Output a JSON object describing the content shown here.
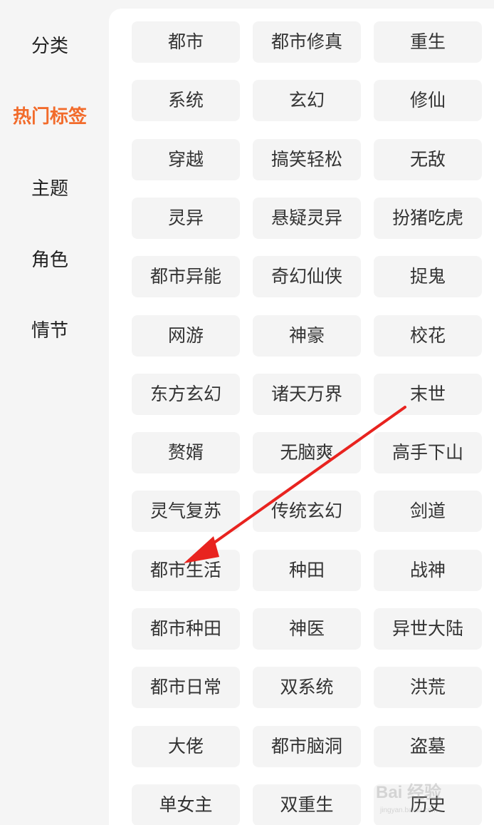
{
  "sidebar": {
    "items": [
      {
        "label": "分类",
        "active": false
      },
      {
        "label": "热门标签",
        "active": true
      },
      {
        "label": "主题",
        "active": false
      },
      {
        "label": "角色",
        "active": false
      },
      {
        "label": "情节",
        "active": false
      }
    ]
  },
  "tags": [
    [
      "都市",
      "都市修真",
      "重生"
    ],
    [
      "系统",
      "玄幻",
      "修仙"
    ],
    [
      "穿越",
      "搞笑轻松",
      "无敌"
    ],
    [
      "灵异",
      "悬疑灵异",
      "扮猪吃虎"
    ],
    [
      "都市异能",
      "奇幻仙侠",
      "捉鬼"
    ],
    [
      "网游",
      "神豪",
      "校花"
    ],
    [
      "东方玄幻",
      "诸天万界",
      "末世"
    ],
    [
      "赘婿",
      "无脑爽",
      "高手下山"
    ],
    [
      "灵气复苏",
      "传统玄幻",
      "剑道"
    ],
    [
      "都市生活",
      "种田",
      "战神"
    ],
    [
      "都市种田",
      "神医",
      "异世大陆"
    ],
    [
      "都市日常",
      "双系统",
      "洪荒"
    ],
    [
      "大佬",
      "都市脑洞",
      "盗墓"
    ],
    [
      "单女主",
      "双重生",
      "历史"
    ]
  ],
  "annotation": {
    "color": "#e8231f",
    "points_to": "都市生活"
  },
  "watermark": {
    "text": "Bai 经验",
    "subtext": "jingyan.baidu.com"
  },
  "colors": {
    "accent": "#f26b2b",
    "tag_bg": "#f4f4f4"
  }
}
